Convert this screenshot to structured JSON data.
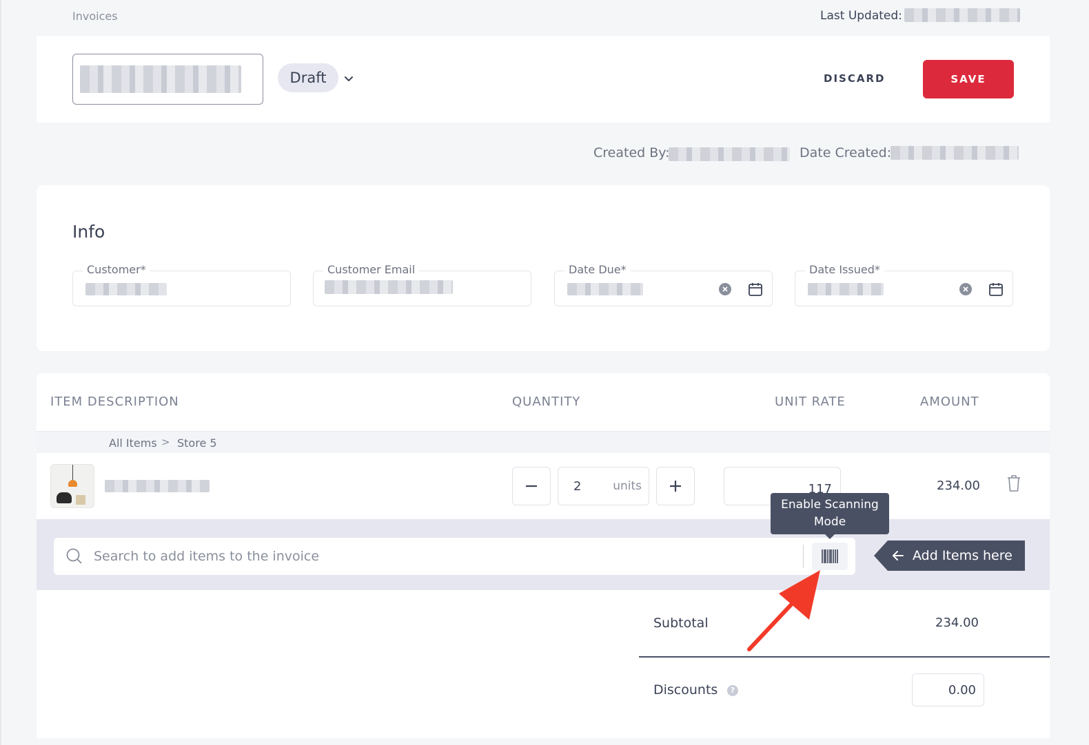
{
  "breadcrumb": {
    "label": "Invoices"
  },
  "last_updated": {
    "label": "Last Updated:"
  },
  "header": {
    "status": "Draft",
    "discard_label": "DISCARD",
    "save_label": "SAVE"
  },
  "meta": {
    "created_by_label": "Created By:",
    "date_created_label": "Date Created:"
  },
  "info": {
    "title": "Info",
    "fields": {
      "customer": "Customer*",
      "customer_email": "Customer Email",
      "date_due": "Date Due*",
      "date_issued": "Date Issued*"
    }
  },
  "table": {
    "headers": {
      "item": "ITEM DESCRIPTION",
      "quantity": "QUANTITY",
      "unit_rate": "UNIT RATE",
      "amount": "AMOUNT"
    },
    "path": {
      "root": "All Items",
      "sep": ">",
      "current": "Store 5"
    },
    "row": {
      "quantity": "2",
      "unit": "units",
      "unit_rate": "117",
      "amount": "234.00"
    }
  },
  "search": {
    "placeholder": "Search to add items to the invoice",
    "tooltip": "Enable Scanning Mode",
    "add_hint": "Add Items here"
  },
  "totals": {
    "subtotal_label": "Subtotal",
    "subtotal_value": "234.00",
    "discounts_label": "Discounts",
    "discounts_value": "0.00"
  },
  "colors": {
    "primary": "#dc2a3c",
    "tooltip_bg": "#4a5064",
    "arrow": "#f23a28",
    "search_band": "#e5e6ef"
  },
  "icons": [
    "chevron-down-icon",
    "clear-icon",
    "calendar-icon",
    "minus-icon",
    "plus-icon",
    "trash-icon",
    "search-icon",
    "barcode-icon",
    "arrow-left-icon",
    "help-icon"
  ]
}
